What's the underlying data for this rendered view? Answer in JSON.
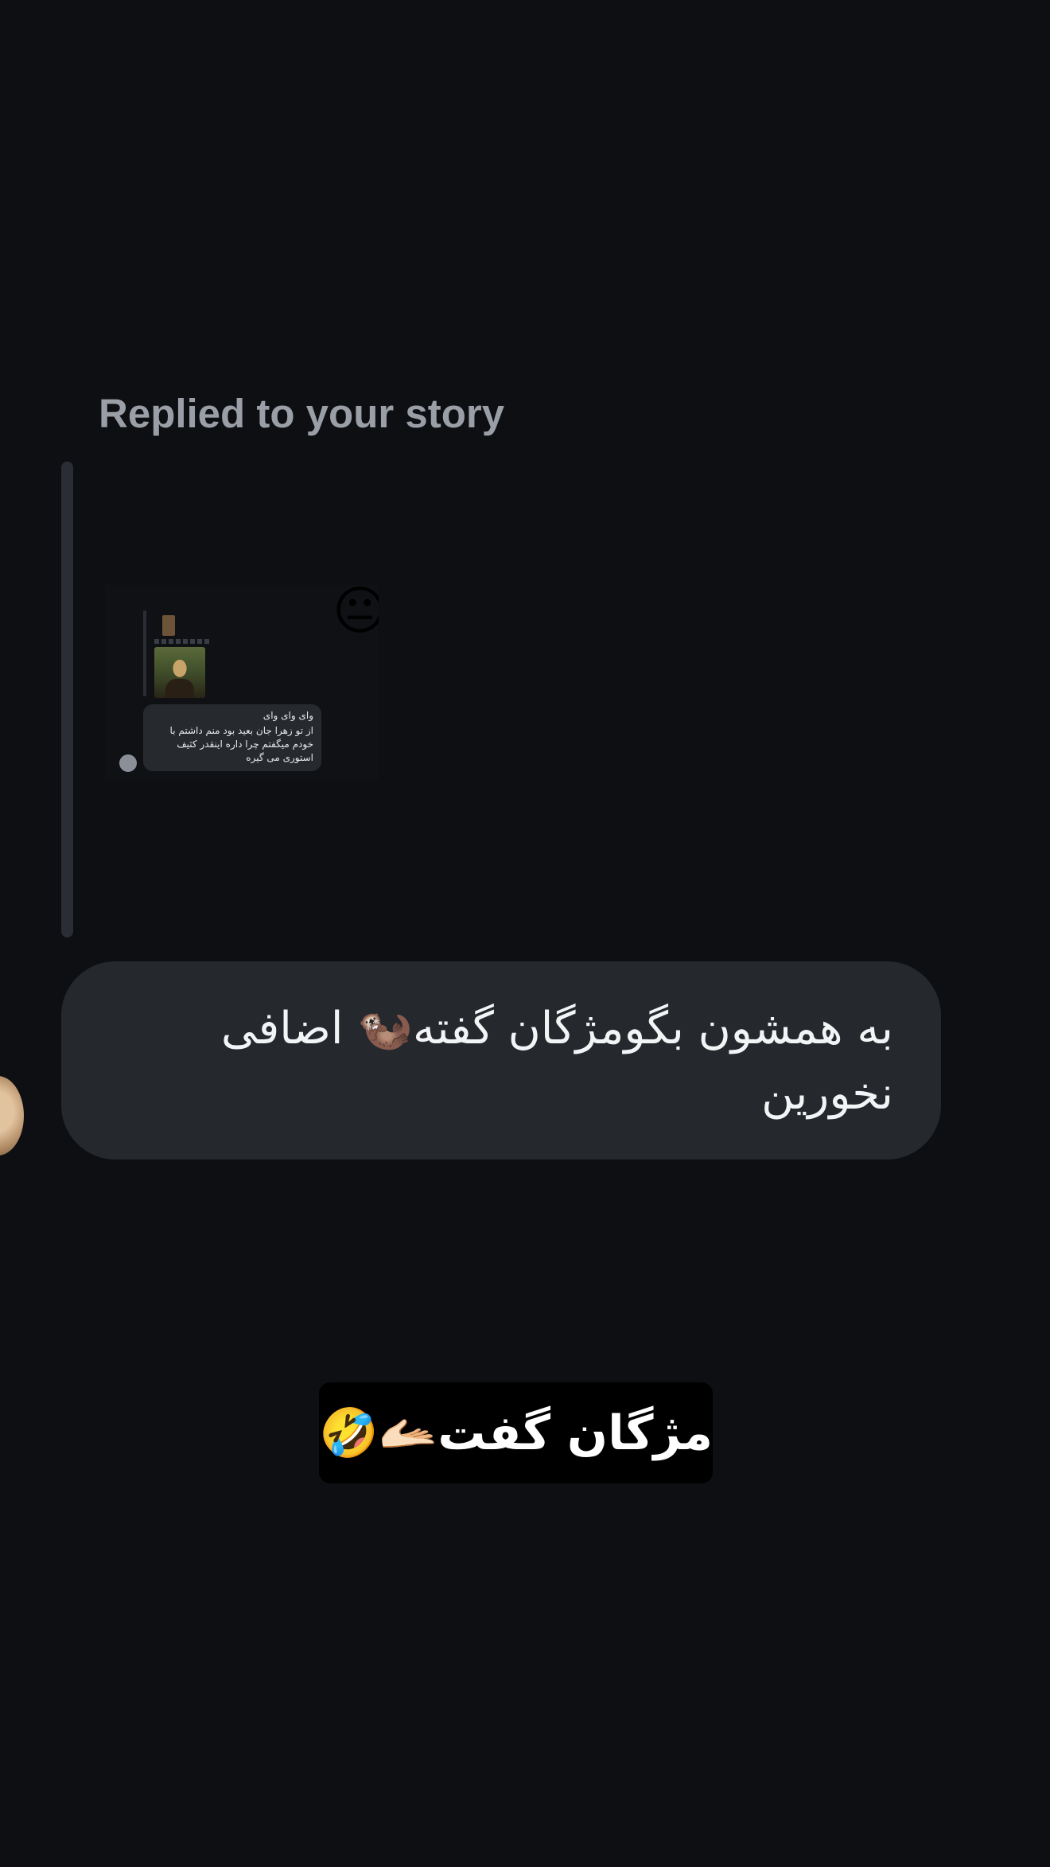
{
  "reply": {
    "label": "Replied to your story"
  },
  "story_preview": {
    "emoji": "😐",
    "bubble_line1": "وای وای وای",
    "bubble_line2": "از تو زهرا جان بعید بود منم داشتم با خودم میگفتم چرا داره اینقدر کثیف استوری می گیره"
  },
  "message": {
    "text": "به همشون بگومژگان گفته🦦 اضافی نخورین"
  },
  "caption": {
    "text": "مژگان گفت🫴🏻🤣"
  },
  "colors": {
    "background": "#0d0f13",
    "bubble": "#25282d",
    "label": "#9a9ea6",
    "caption_bg": "#000000"
  }
}
